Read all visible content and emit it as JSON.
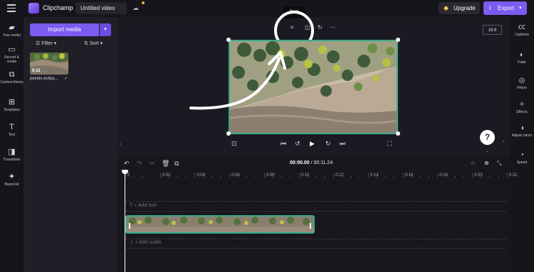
{
  "header": {
    "app_name": "Clipchamp",
    "project_title": "Untitled video",
    "upgrade_label": "Upgrade",
    "export_label": "Export"
  },
  "left_rail": {
    "items": [
      {
        "label": "Your media",
        "icon": "folder-icon"
      },
      {
        "label": "Record & create",
        "icon": "camera-icon"
      },
      {
        "label": "Content library",
        "icon": "library-icon"
      },
      {
        "label": "Templates",
        "icon": "templates-icon"
      },
      {
        "label": "Text",
        "icon": "text-icon"
      },
      {
        "label": "Transitions",
        "icon": "transitions-icon"
      },
      {
        "label": "Brand kit",
        "icon": "brand-kit-icon"
      }
    ]
  },
  "media_panel": {
    "import_label": "Import media",
    "filter_label": "Filter",
    "sort_label": "Sort",
    "asset": {
      "duration": "0:11",
      "name": "pexels-eclips..."
    }
  },
  "preview": {
    "tooltip": "Crop",
    "aspect_ratio": "16:9"
  },
  "right_rail": {
    "items": [
      {
        "label": "Captions",
        "icon": "captions-icon"
      },
      {
        "label": "Fade",
        "icon": "fade-icon"
      },
      {
        "label": "Filters",
        "icon": "filters-icon"
      },
      {
        "label": "Effects",
        "icon": "effects-icon"
      },
      {
        "label": "Adjust colors",
        "icon": "adjust-colors-icon"
      },
      {
        "label": "Speed",
        "icon": "speed-icon"
      }
    ]
  },
  "timeline": {
    "current_time": "00:00.00",
    "total_time": "00:11.24",
    "ruler": [
      "0",
      "0:02",
      "0:04",
      "0:06",
      "0:08",
      "0:10",
      "0:12",
      "0:14",
      "0:16",
      "0:18",
      "0:20",
      "0:22"
    ],
    "add_text_label": "+ Add text",
    "add_audio_label": "+ Add audio"
  },
  "colors": {
    "accent": "#7b5cf0",
    "selection": "#3aa98a",
    "background": "#1b1a22"
  }
}
